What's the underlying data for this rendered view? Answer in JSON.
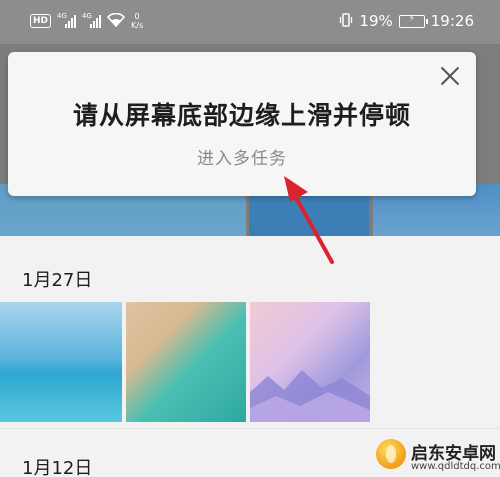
{
  "status_bar": {
    "hd": "HD",
    "signal_1": "4G",
    "signal_2": "4G",
    "speed_value": "0",
    "speed_unit": "K/s",
    "battery": "19%",
    "time": "19:26"
  },
  "hint": {
    "title": "请从屏幕底部边缘上滑并停顿",
    "subtitle": "进入多任务"
  },
  "gallery": {
    "sections": [
      {
        "date": "1月27日"
      },
      {
        "date": "1月12日"
      }
    ]
  },
  "watermark": {
    "name": "启东安卓网",
    "url": "www.qdldtdq.com"
  },
  "colors": {
    "annotation_arrow": "#d9232d"
  }
}
